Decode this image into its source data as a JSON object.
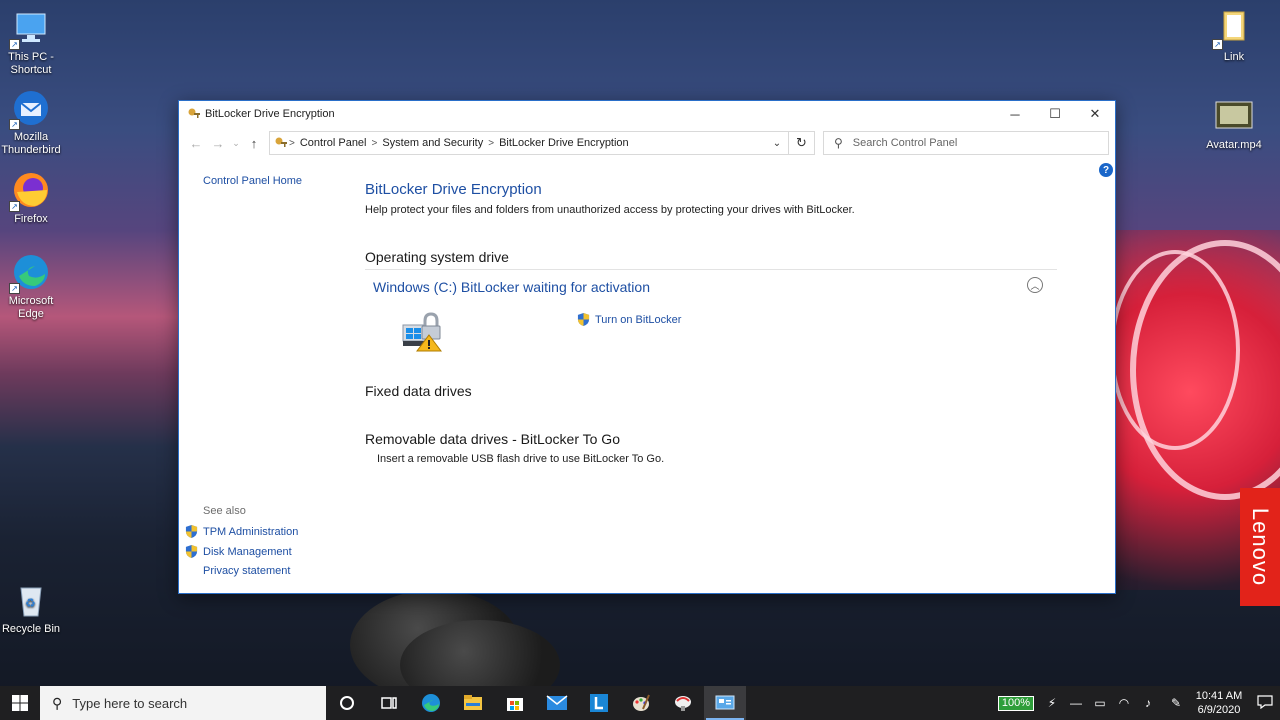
{
  "desktop": {
    "icons_left": [
      {
        "label": "This PC - Shortcut",
        "icon": "computer-icon"
      },
      {
        "label": "Mozilla Thunderbird",
        "icon": "thunderbird-icon"
      },
      {
        "label": "Firefox",
        "icon": "firefox-icon"
      },
      {
        "label": "Microsoft Edge",
        "icon": "edge-icon"
      },
      {
        "label": "Recycle Bin",
        "icon": "recycle-bin-icon"
      }
    ],
    "icons_right": [
      {
        "label": "Link",
        "icon": "folder-icon"
      },
      {
        "label": "Avatar.mp4",
        "icon": "video-file-icon"
      }
    ],
    "brand": "Lenovo"
  },
  "window": {
    "title": "BitLocker Drive Encryption",
    "address": {
      "crumbs": [
        "Control Panel",
        "System and Security",
        "BitLocker Drive Encryption"
      ]
    },
    "search": {
      "placeholder": "Search Control Panel"
    },
    "help": "?",
    "sidebar": {
      "home": "Control Panel Home",
      "see_also": "See also",
      "links": [
        "TPM Administration",
        "Disk Management"
      ],
      "privacy": "Privacy statement"
    },
    "main": {
      "title": "BitLocker Drive Encryption",
      "description": "Help protect your files and folders from unauthorized access by protecting your drives with BitLocker.",
      "os_drive_heading": "Operating system drive",
      "drive_title": "Windows (C:) BitLocker waiting for activation",
      "turn_on": "Turn on BitLocker",
      "fixed_heading": "Fixed data drives",
      "removable_heading": "Removable data drives - BitLocker To Go",
      "removable_desc": "Insert a removable USB flash drive to use BitLocker To Go."
    }
  },
  "taskbar": {
    "search_placeholder": "Type here to search",
    "apps": [
      "cortana-icon",
      "task-view-icon",
      "edge-icon",
      "file-explorer-icon",
      "store-icon",
      "mail-icon",
      "l-app-icon",
      "paint-icon",
      "snipping-icon",
      "control-panel-icon"
    ],
    "battery": "100%",
    "time": "10:41 AM",
    "date": "6/9/2020"
  }
}
